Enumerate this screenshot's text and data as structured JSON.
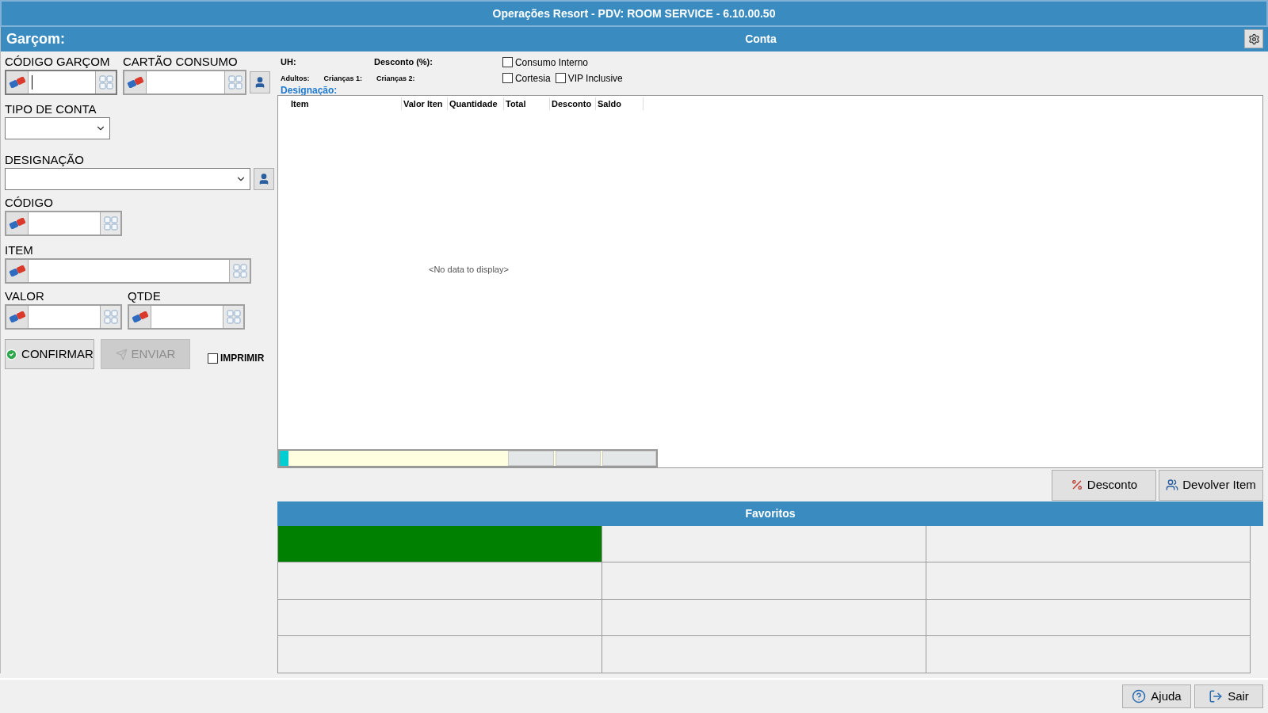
{
  "window": {
    "title": "Operações Resort - PDV: ROOM SERVICE - 6.10.00.50"
  },
  "left_panel": {
    "header": "Garçom:",
    "rows": [
      [
        {
          "label": "CÓDIGO GARÇOM",
          "kind": "keypad",
          "focused": true,
          "lookup_button": false
        },
        {
          "label": "CARTÃO CONSUMO",
          "kind": "keypad",
          "focused": false,
          "lookup_button": true
        }
      ],
      [
        {
          "label": "TIPO DE CONTA",
          "kind": "dropdown",
          "focused": false,
          "lookup_button": false
        }
      ],
      [
        {
          "label": "DESIGNAÇÃO",
          "kind": "dropdown_wide",
          "focused": false,
          "lookup_button": true
        }
      ],
      [
        {
          "label": "CÓDIGO",
          "kind": "keypad",
          "focused": false,
          "lookup_button": false
        }
      ],
      [
        {
          "label": "ITEM",
          "kind": "keypad_wide",
          "focused": false,
          "lookup_button": false
        }
      ],
      [
        {
          "label": "VALOR",
          "kind": "keypad",
          "focused": false,
          "lookup_button": false
        },
        {
          "label": "QTDE",
          "kind": "keypad",
          "focused": false,
          "lookup_button": false
        }
      ]
    ],
    "buttons": [
      {
        "label": "CONFIRMAR",
        "disabled": false
      },
      {
        "label": "ENVIAR",
        "disabled": true
      }
    ],
    "print_checkbox": {
      "label": "IMPRIMIR",
      "checked": false
    }
  },
  "account": {
    "header": "Conta",
    "uh_label": "UH:",
    "discount_label": "Desconto (%):",
    "guests": [
      "Adultos:",
      "Crianças 1:",
      "Crianças 2:"
    ],
    "designation_label": "Designação:",
    "checkboxes": [
      {
        "label": "Consumo Interno",
        "checked": false
      },
      {
        "label": "Cortesia",
        "checked": false
      },
      {
        "label": "VIP Inclusive",
        "checked": false
      }
    ],
    "table": {
      "columns": [
        "Item",
        "Valor Iten",
        "Quantidade",
        "Total",
        "Desconto",
        "Saldo"
      ],
      "empty_text": "<No data to display>"
    },
    "actions": [
      "Desconto",
      "Devolver Item"
    ]
  },
  "favorites": {
    "header": "Favoritos",
    "tiles": [
      {
        "color": "#008000"
      },
      {
        "color": "#f0f0f0"
      },
      {
        "color": "#f0f0f0"
      },
      {
        "color": "#f0f0f0"
      },
      {
        "color": "#f0f0f0"
      },
      {
        "color": "#f0f0f0"
      },
      {
        "color": "#f0f0f0"
      },
      {
        "color": "#f0f0f0"
      },
      {
        "color": "#f0f0f0"
      },
      {
        "color": "#f0f0f0"
      },
      {
        "color": "#f0f0f0"
      },
      {
        "color": "#f0f0f0"
      }
    ]
  },
  "footer_buttons": [
    "Ajuda",
    "Sair"
  ]
}
